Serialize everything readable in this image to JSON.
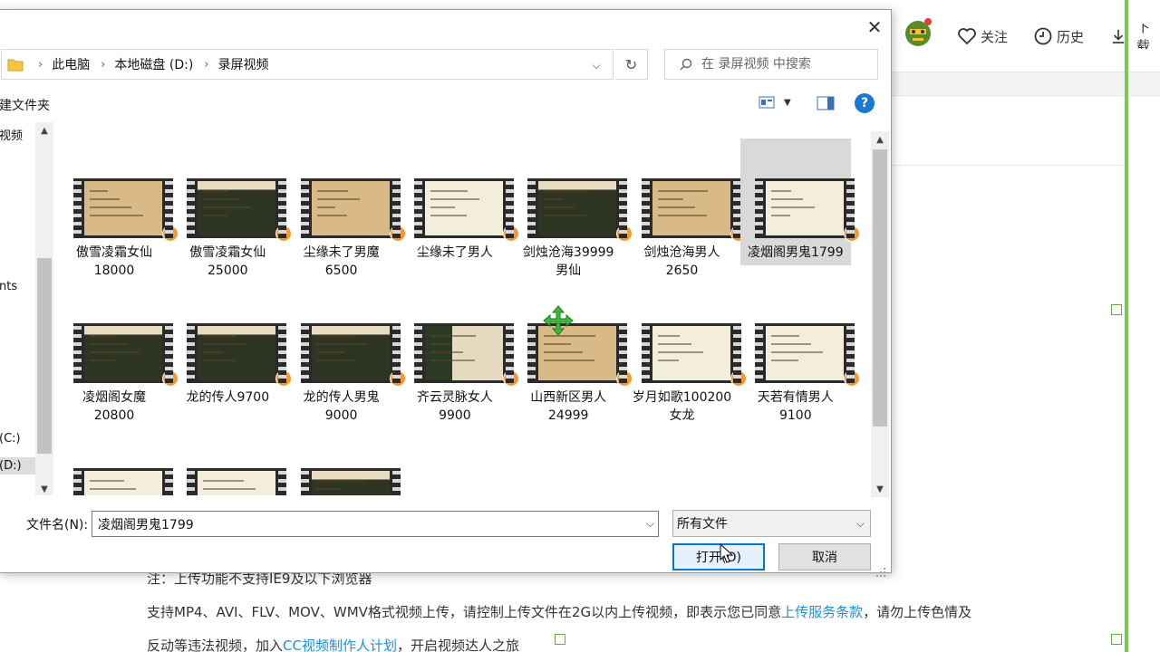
{
  "header": {
    "follow_label": "关注",
    "history_label": "历史",
    "download_label": "下载"
  },
  "page": {
    "notice": "注：上传功能不支持IE9及以下浏览器",
    "formats_text_1": "支持MP4、AVI、FLV、MOV、WMV格式视频上传，请控制上传文件在2G以内上传视频，即表示您已同意",
    "terms_link": "上传服务条款",
    "formats_text_2": "，请勿上传色情及",
    "line3_text_1": "反动等违法视频，加入",
    "cc_link": "CC视频制作人计划",
    "line3_text_2": "，开启视频达人之旅"
  },
  "dialog": {
    "breadcrumb": [
      "此电脑",
      "本地磁盘 (D:)",
      "录屏视频"
    ],
    "search_placeholder": "在 录屏视频 中搜索",
    "new_folder_label": "建文件夹",
    "help_label": "?",
    "nav": {
      "item_video": "视频",
      "item_nts": "nts",
      "drive_c": "(C:)",
      "drive_d": "(D:)"
    },
    "files": [
      {
        "line1": "傲雪凌霜女仙",
        "line2": "18000",
        "style": "plain"
      },
      {
        "line1": "傲雪凌霜女仙",
        "line2": "25000",
        "style": "dark"
      },
      {
        "line1": "尘缘未了男魔",
        "line2": "6500",
        "style": "plain"
      },
      {
        "line1": "尘缘未了男人",
        "line2": "",
        "style": "light"
      },
      {
        "line1": "剑烛沧海39999",
        "line2": "男仙",
        "style": "dark"
      },
      {
        "line1": "剑烛沧海男人",
        "line2": "2650",
        "style": "plain"
      },
      {
        "line1": "凌烟阁男鬼1799",
        "line2": "",
        "style": "light",
        "selected": true
      },
      {
        "line1": "凌烟阁女魔",
        "line2": "20800",
        "style": "dark"
      },
      {
        "line1": "龙的传人9700",
        "line2": "",
        "style": "dark"
      },
      {
        "line1": "龙的传人男鬼",
        "line2": "9000",
        "style": "dark"
      },
      {
        "line1": "齐云灵脉女人",
        "line2": "9900",
        "style": "mixed"
      },
      {
        "line1": "山西新区男人",
        "line2": "24999",
        "style": "plain"
      },
      {
        "line1": "岁月如歌100200",
        "line2": "女龙",
        "style": "light"
      },
      {
        "line1": "天若有情男人",
        "line2": "9100",
        "style": "light"
      },
      {
        "line1": "",
        "line2": "",
        "style": "light"
      },
      {
        "line1": "",
        "line2": "",
        "style": "light"
      },
      {
        "line1": "",
        "line2": "",
        "style": "dark"
      }
    ],
    "filename_label": "文件名(N):",
    "filename_value": "凌烟阁男鬼1799",
    "filetype_value": "所有文件",
    "open_label": "打开(O)",
    "cancel_label": "取消"
  },
  "colors": {
    "accent": "#0078d7",
    "link": "#1e8fd6",
    "green_border": "#7cc756",
    "play_badge": "#f29a2e"
  }
}
